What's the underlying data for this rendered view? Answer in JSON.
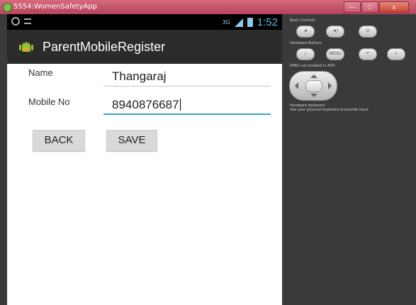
{
  "window": {
    "title": "5554:WomenSafetyApp",
    "buttons": [
      "—",
      "□",
      "x"
    ]
  },
  "status_bar": {
    "network": "3G",
    "time": "1:52"
  },
  "action_bar": {
    "title": "ParentMobileRegister",
    "icon": "android-icon"
  },
  "form": {
    "name_label": "Name",
    "name_value": "Thangaraj",
    "mobile_label": "Mobile No",
    "mobile_value": "8940876687"
  },
  "buttons": {
    "back": "BACK",
    "save": "SAVE"
  },
  "control_panel": {
    "basic_controls_heading": "Basic Controls",
    "hardware_buttons_heading": "Hardware Buttons",
    "menu_label": "MENU",
    "dpad_note": "DPAD not enabled in AVD",
    "keyboard_heading": "Hardware Keyboard",
    "keyboard_note": "Use your physical keyboard to provide input"
  },
  "colors": {
    "accent": "#3aa2d6",
    "statusbar_time": "#59b6e6",
    "actionbar": "#2b2b2b",
    "titlebar": "#c9566c"
  }
}
